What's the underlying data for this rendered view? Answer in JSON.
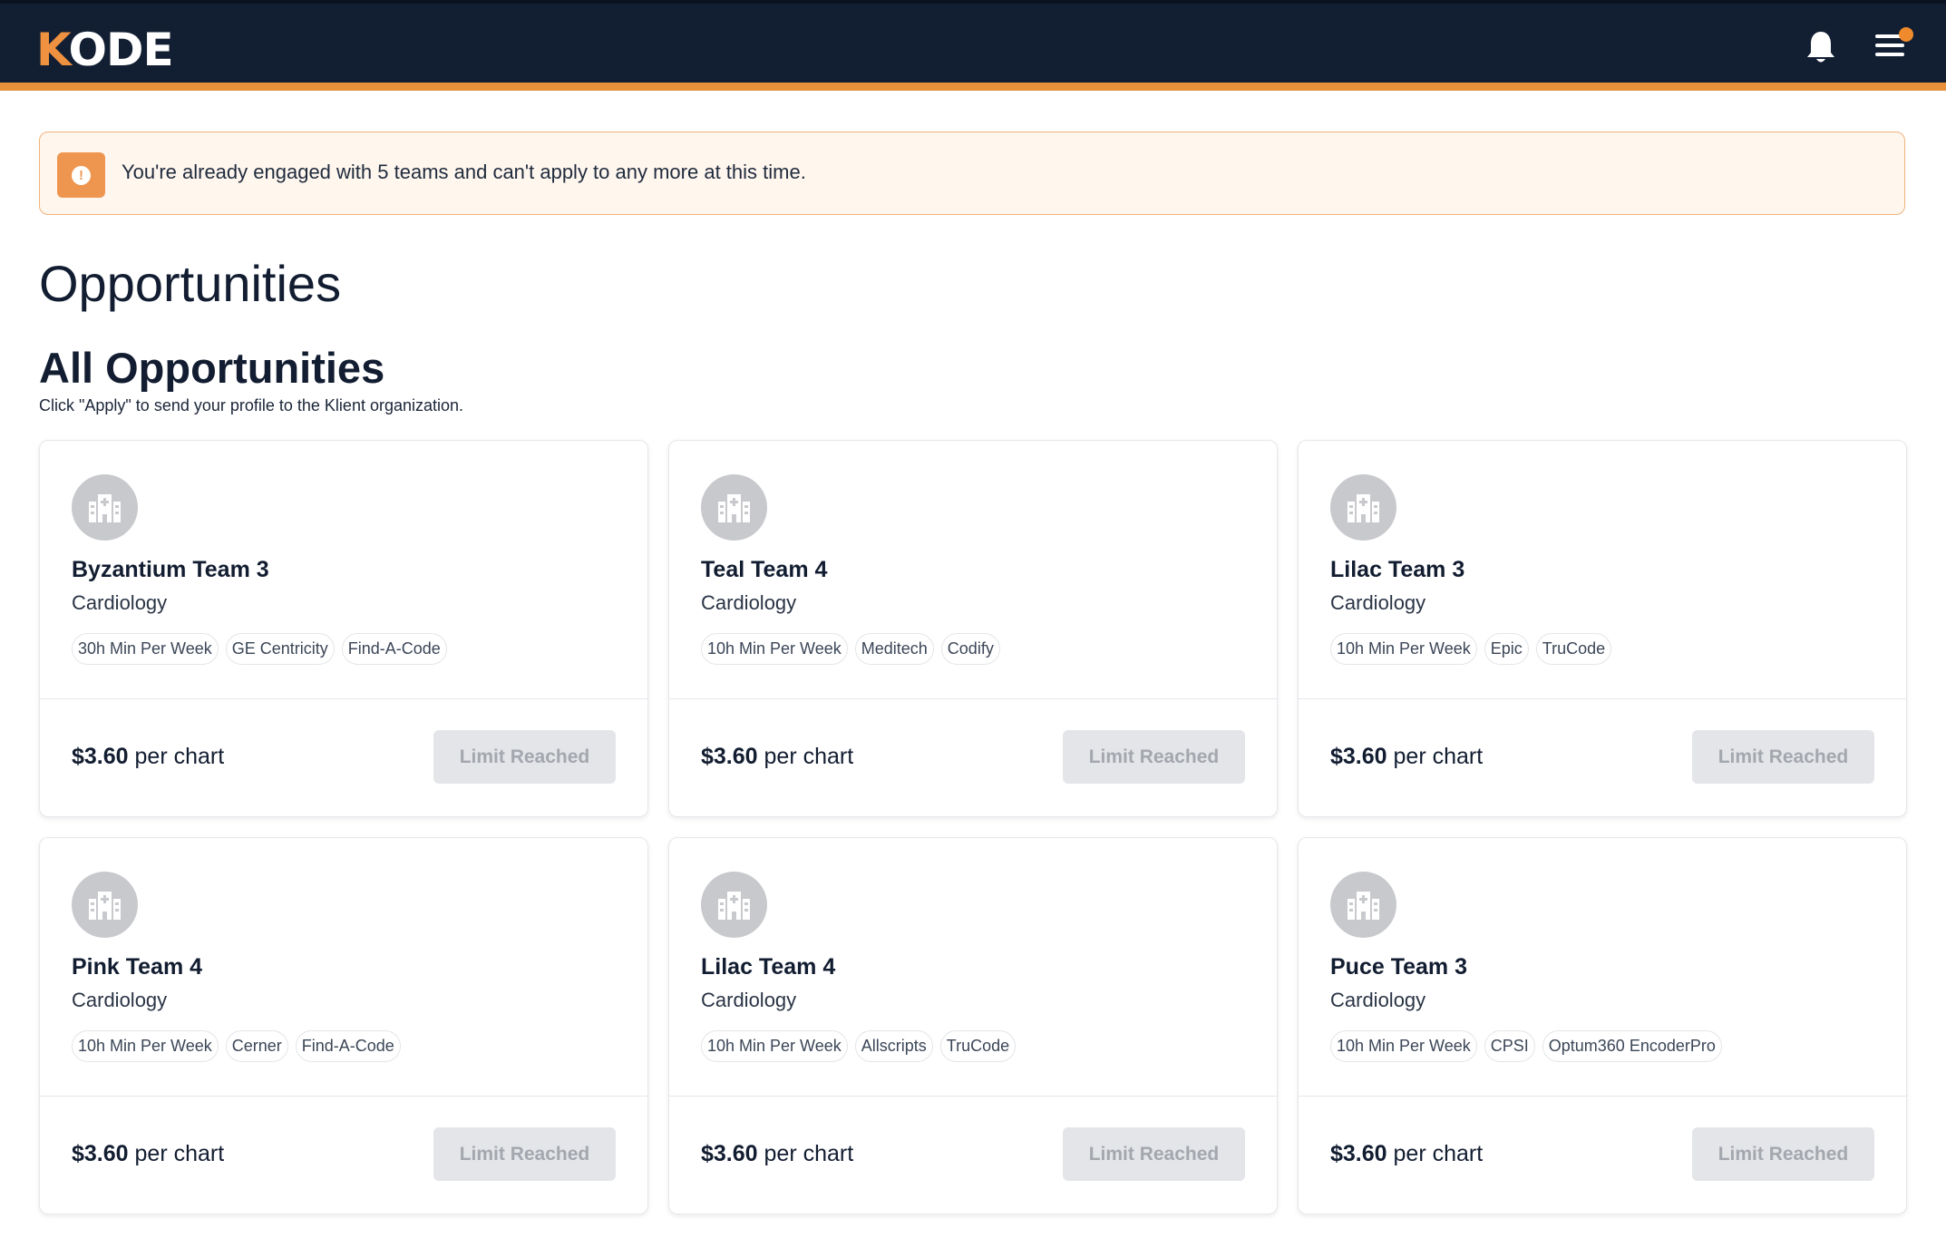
{
  "header": {
    "logo_k": "K",
    "logo_rest": "ODE"
  },
  "alert": {
    "text": "You're already engaged with 5 teams and can't apply to any more at this time."
  },
  "page": {
    "title": "Opportunities"
  },
  "section": {
    "title": "All Opportunities",
    "subtitle": "Click \"Apply\" to send your profile to the Klient organization."
  },
  "cards": [
    {
      "name": "Byzantium Team 3",
      "specialty": "Cardiology",
      "tags": [
        "30h Min Per Week",
        "GE Centricity",
        "Find-A-Code"
      ],
      "price": "$3.60",
      "price_unit": " per chart",
      "button": "Limit Reached"
    },
    {
      "name": "Teal Team 4",
      "specialty": "Cardiology",
      "tags": [
        "10h Min Per Week",
        "Meditech",
        "Codify"
      ],
      "price": "$3.60",
      "price_unit": " per chart",
      "button": "Limit Reached"
    },
    {
      "name": "Lilac Team 3",
      "specialty": "Cardiology",
      "tags": [
        "10h Min Per Week",
        "Epic",
        "TruCode"
      ],
      "price": "$3.60",
      "price_unit": " per chart",
      "button": "Limit Reached"
    },
    {
      "name": "Pink Team 4",
      "specialty": "Cardiology",
      "tags": [
        "10h Min Per Week",
        "Cerner",
        "Find-A-Code"
      ],
      "price": "$3.60",
      "price_unit": " per chart",
      "button": "Limit Reached"
    },
    {
      "name": "Lilac Team 4",
      "specialty": "Cardiology",
      "tags": [
        "10h Min Per Week",
        "Allscripts",
        "TruCode"
      ],
      "price": "$3.60",
      "price_unit": " per chart",
      "button": "Limit Reached"
    },
    {
      "name": "Puce Team 3",
      "specialty": "Cardiology",
      "tags": [
        "10h Min Per Week",
        "CPSI",
        "Optum360 EncoderPro"
      ],
      "price": "$3.60",
      "price_unit": " per chart",
      "button": "Limit Reached"
    }
  ],
  "colors": {
    "navy": "#121f33",
    "accent": "#e8913a",
    "alert_bg": "#fff6ee"
  },
  "icons": {
    "notifications": "bell-icon",
    "menu": "hamburger-menu-icon",
    "team": "hospital-building-icon",
    "alert": "exclamation-circle-icon"
  }
}
